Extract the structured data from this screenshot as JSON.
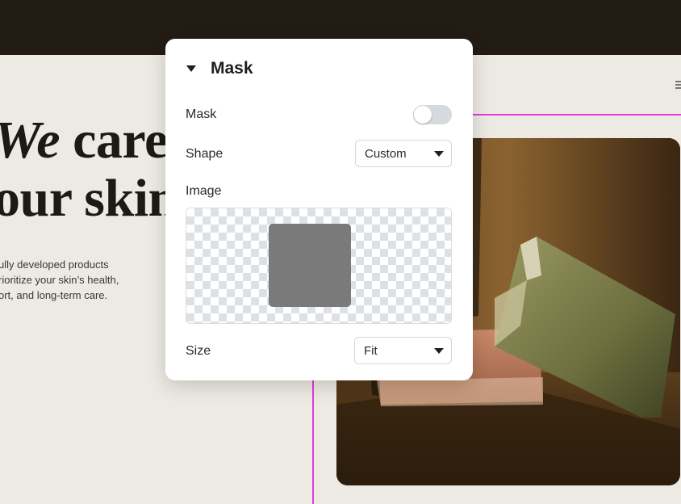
{
  "hero": {
    "heading_line1_italic": "We",
    "heading_line1_rest": " care",
    "heading_line2": "our skin",
    "body_lines": [
      "ully developed products",
      "rioritize your skin’s health,",
      "ort, and long-term care."
    ]
  },
  "panel": {
    "title": "Mask",
    "mask_label": "Mask",
    "mask_enabled": false,
    "shape_label": "Shape",
    "shape_value": "Custom",
    "image_label": "Image",
    "size_label": "Size",
    "size_value": "Fit"
  },
  "colors": {
    "topbar": "#221c14",
    "canvas_bg": "#ede9e3",
    "guide": "#e23ae0",
    "panel_bg": "#ffffff",
    "mask_preview": "#7a7a7a"
  }
}
